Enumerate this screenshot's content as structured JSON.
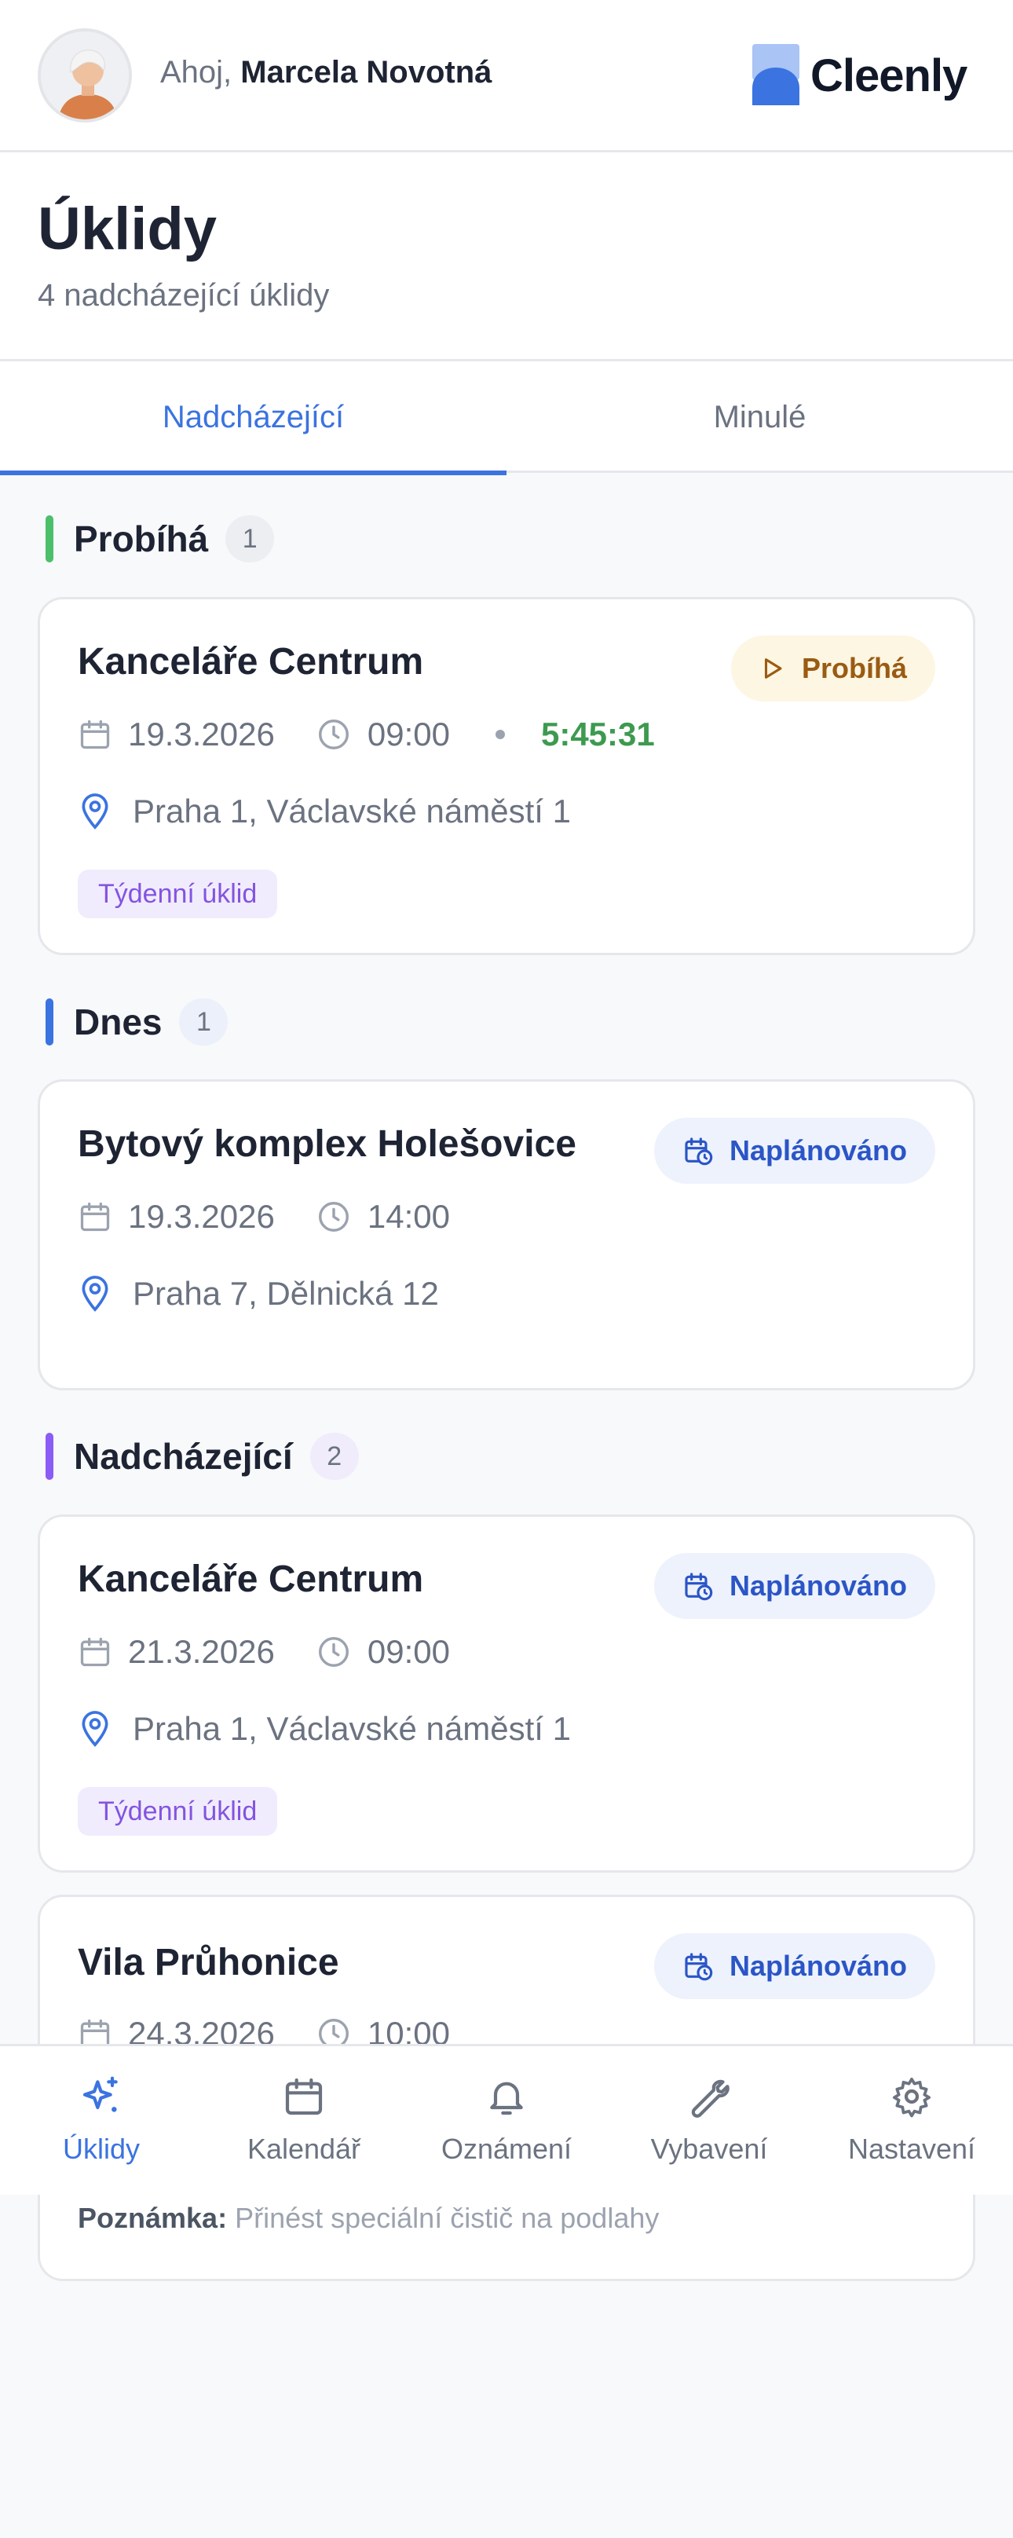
{
  "header": {
    "greeting_prefix": "Ahoj, ",
    "user_name": "Marcela Novotná",
    "logo_text": "Cleenly"
  },
  "page": {
    "title": "Úklidy",
    "subtitle": "4 nadcházející úklidy"
  },
  "tabs": [
    {
      "label": "Nadcházející",
      "active": true
    },
    {
      "label": "Minulé",
      "active": false
    }
  ],
  "sections": [
    {
      "title": "Probíhá",
      "count": "1",
      "color": "#4cbf6b"
    },
    {
      "title": "Dnes",
      "count": "1",
      "color": "#3b73e0"
    },
    {
      "title": "Nadcházející",
      "count": "2",
      "color": "#8b5cf6"
    }
  ],
  "cards": [
    {
      "title": "Kanceláře Centrum",
      "status": "Probíhá",
      "date": "19.3.2026",
      "time": "09:00",
      "timer": "5:45:31",
      "address": "Praha 1, Václavské náměstí 1",
      "tag": "Týdenní úklid"
    },
    {
      "title": "Bytový komplex Holešovice",
      "status": "Naplánováno",
      "date": "19.3.2026",
      "time": "14:00",
      "address": "Praha 7, Dělnická 12"
    },
    {
      "title": "Kanceláře Centrum",
      "status": "Naplánováno",
      "date": "21.3.2026",
      "time": "09:00",
      "address": "Praha 1, Václavské náměstí 1",
      "tag": "Týdenní úklid"
    },
    {
      "title": "Vila Průhonice",
      "status": "Naplánováno",
      "date": "24.3.2026",
      "time": "10:00",
      "note_label": "Poznámka:",
      "note_text": "Přinést speciální čistič na podlahy"
    }
  ],
  "bottom_nav": [
    {
      "label": "Úklidy",
      "icon": "sparkles-icon",
      "active": true
    },
    {
      "label": "Kalendář",
      "icon": "calendar-icon",
      "active": false
    },
    {
      "label": "Oznámení",
      "icon": "bell-icon",
      "active": false
    },
    {
      "label": "Vybavení",
      "icon": "wrench-icon",
      "active": false
    },
    {
      "label": "Nastavení",
      "icon": "gear-icon",
      "active": false
    }
  ],
  "colors": {
    "accent": "#3b73e0",
    "running": "#9a5b12",
    "timer": "#3d9a4f",
    "tag": "#8354e0"
  }
}
